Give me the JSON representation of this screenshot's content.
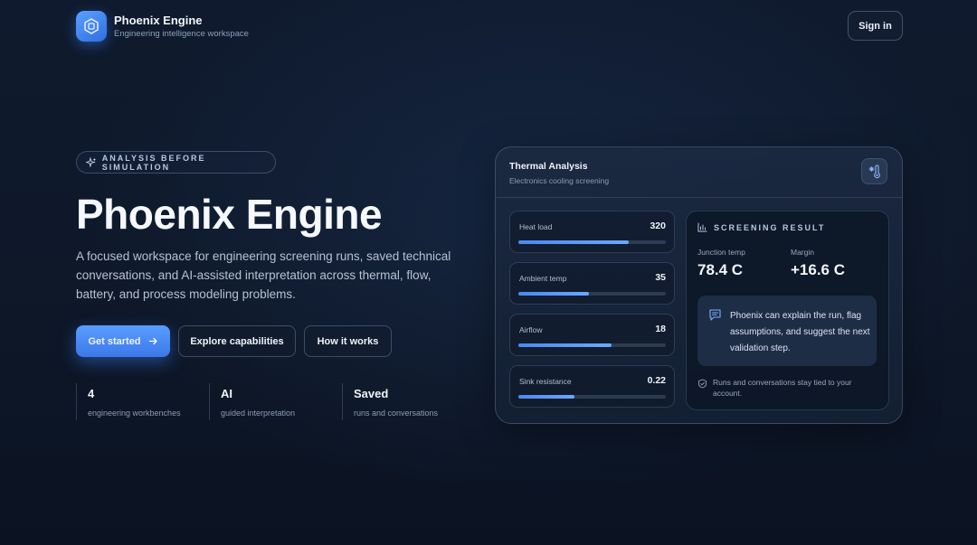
{
  "brand": {
    "name": "Phoenix Engine",
    "tagline": "Engineering intelligence workspace",
    "sign_in_label": "Sign in"
  },
  "hero": {
    "pill_label": "ANALYSIS BEFORE SIMULATION",
    "title": "Phoenix Engine",
    "description": "A focused workspace for engineering screening runs, saved technical conversations, and AI-assisted interpretation across thermal, flow, battery, and process modeling problems.",
    "buttons": {
      "primary": "Get started",
      "explore": "Explore capabilities",
      "how": "How it works"
    },
    "stats": [
      {
        "value": "4",
        "label": "engineering workbenches"
      },
      {
        "value": "AI",
        "label": "guided interpretation"
      },
      {
        "value": "Saved",
        "label": "runs and conversations"
      }
    ]
  },
  "card": {
    "title": "Thermal Analysis",
    "subtitle": "Electronics cooling screening",
    "icon": "thermometer-snow-icon",
    "inputs": [
      {
        "label": "Heat load",
        "value": "320",
        "level": 0.75
      },
      {
        "label": "Ambient temp",
        "value": "35",
        "level": 0.48
      },
      {
        "label": "Airflow",
        "value": "18",
        "level": 0.63
      },
      {
        "label": "Sink resistance",
        "value": "0.22",
        "level": 0.38
      }
    ],
    "result": {
      "title": "SCREENING RESULT",
      "junction_label": "Junction temp",
      "junction_value": "78.4 C",
      "margin_label": "Margin",
      "margin_value": "+16.6 C",
      "chat_text": "Phoenix can explain the run, flag assumptions, and suggest the next validation step.",
      "footnote": "Runs and conversations stay tied to your account."
    }
  },
  "colors": {
    "accent": "#4a8af0",
    "background": "#0f1a2e"
  }
}
